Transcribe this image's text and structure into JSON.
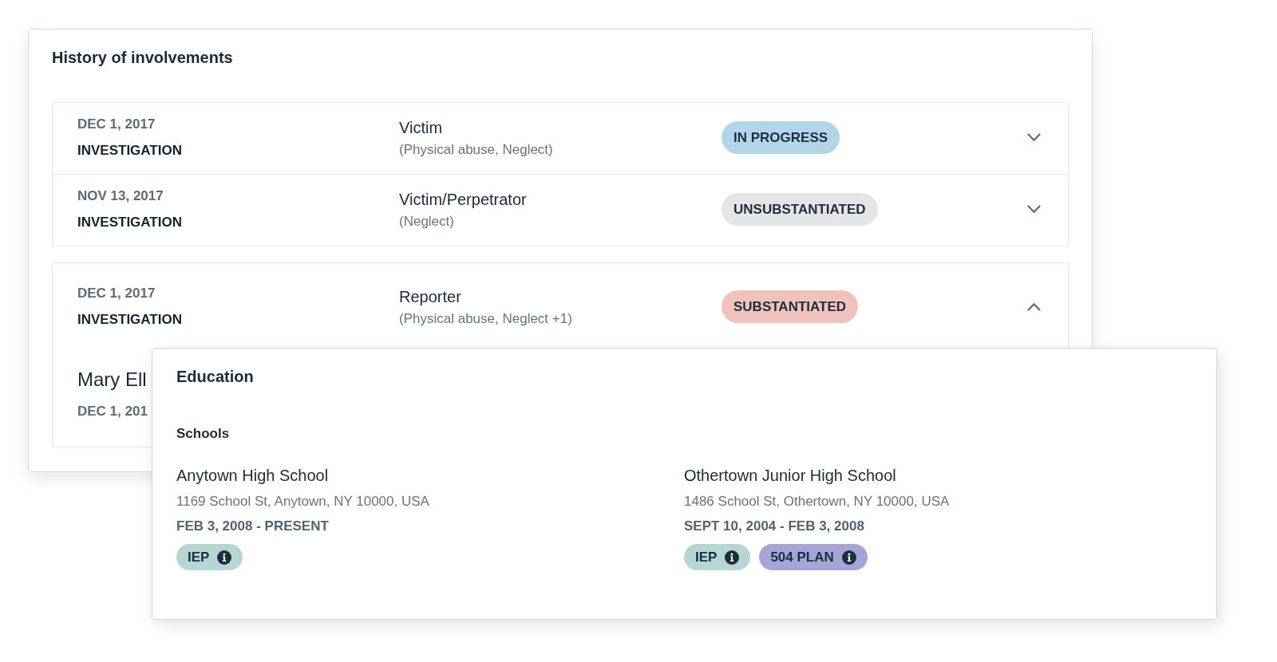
{
  "involvements": {
    "title": "History of involvements",
    "rows": [
      {
        "date": "DEC 1, 2017",
        "type": "INVESTIGATION",
        "role": "Victim",
        "reasons": "(Physical abuse, Neglect)",
        "status": "IN PROGRESS",
        "color": "#b3d5e9",
        "expanded": false
      },
      {
        "date": "NOV 13, 2017",
        "type": "INVESTIGATION",
        "role": "Victim/Perpetrator",
        "reasons": "(Neglect)",
        "status": "UNSUBSTANTIATED",
        "color": "#e4e5e7",
        "expanded": false
      },
      {
        "date": "DEC 1, 2017",
        "type": "INVESTIGATION",
        "role": "Reporter",
        "reasons": "(Physical abuse, Neglect +1)",
        "status": "SUBSTANTIATED",
        "color": "#efc2bc",
        "expanded": true,
        "details": {
          "name": "Mary Ell",
          "date": "DEC 1, 201"
        }
      }
    ]
  },
  "education": {
    "title": "Education",
    "section": "Schools",
    "schools": [
      {
        "name": "Anytown High School",
        "address": "1169 School St, Anytown, NY 10000, USA",
        "dates": "FEB 3, 2008 - PRESENT",
        "tags": [
          {
            "label": "IEP",
            "color": "#b6d6d3"
          }
        ]
      },
      {
        "name": "Othertown Junior High School",
        "address": "1486 School St, Othertown, NY 10000, USA",
        "dates": "SEPT 10, 2004 - FEB 3, 2008",
        "tags": [
          {
            "label": "IEP",
            "color": "#b6d6d3"
          },
          {
            "label": "504 PLAN",
            "color": "#a4a4d6"
          }
        ]
      }
    ]
  }
}
